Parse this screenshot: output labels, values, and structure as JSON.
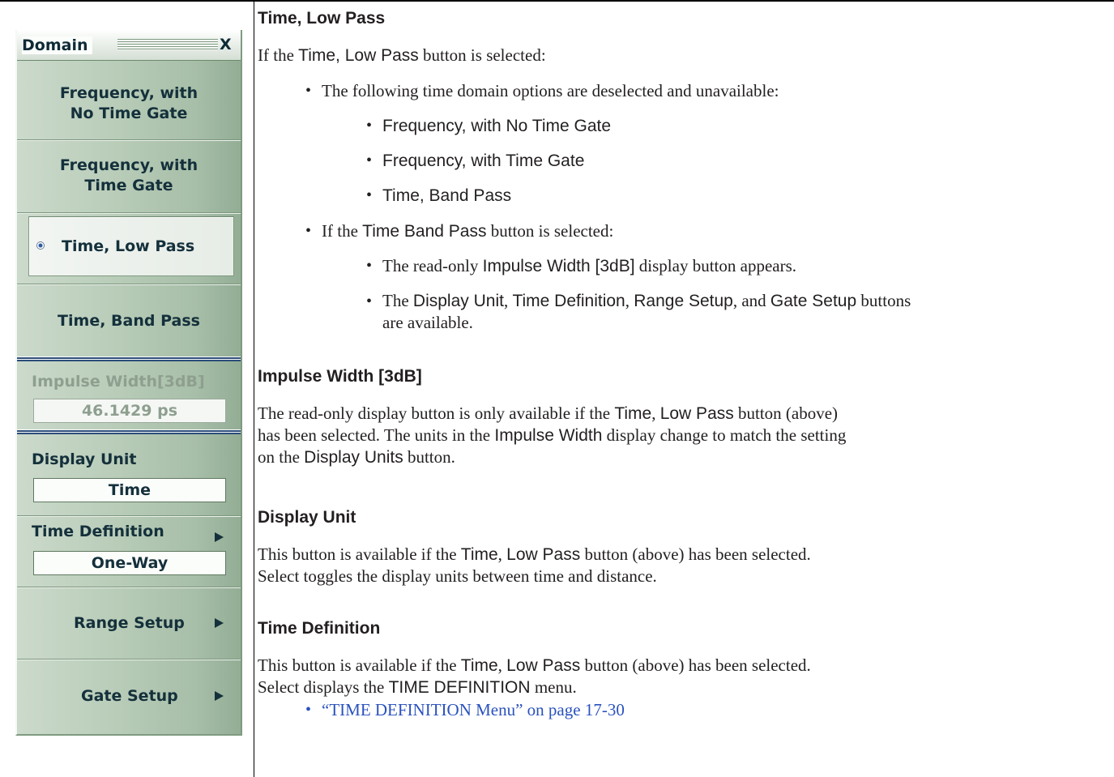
{
  "menu": {
    "title": "Domain",
    "close_label": "X",
    "buttons": {
      "freq_no_gate_line1": "Frequency, with",
      "freq_no_gate_line2": "No Time Gate",
      "freq_gate_line1": "Frequency, with",
      "freq_gate_line2": "Time Gate",
      "time_low_pass": "Time, Low Pass",
      "time_band_pass": "Time, Band Pass"
    },
    "impulse_width": {
      "label": "Impulse Width[3dB]",
      "value": "46.1429 ps"
    },
    "display_unit": {
      "label": "Display Unit",
      "value": "Time"
    },
    "time_definition": {
      "label": "Time Definition",
      "value": "One-Way"
    },
    "range_setup": "Range Setup",
    "gate_setup": "Gate Setup"
  },
  "doc": {
    "s1": {
      "heading": "Time, Low Pass",
      "intro": [
        "If the ",
        "Time, Low Pass",
        " button is selected:"
      ],
      "b1": "The following time domain options are deselected and unavailable:",
      "sub1": [
        "Frequency, with No Time Gate",
        "Frequency, with Time Gate",
        "Time, Band Pass"
      ],
      "b2": [
        "If the ",
        "Time Band Pass",
        " button is selected:"
      ],
      "sub2a": [
        "The read-only ",
        "Impulse Width [3dB]",
        " display button appears."
      ],
      "sub2b": [
        "The ",
        "Display Unit",
        ", ",
        "Time Definition",
        ", ",
        "Range Setup",
        ", and ",
        "Gate Setup",
        " buttons"
      ],
      "sub2b_cont": "are available."
    },
    "s2": {
      "heading": "Impulse Width [3dB]",
      "l1": [
        "The read-only display button is only available if the ",
        "Time",
        ", ",
        "Low Pass",
        " button (above)"
      ],
      "l2": [
        "has been selected. The units in the ",
        "Impulse Width",
        " display change to match the setting"
      ],
      "l3": [
        "on the ",
        "Display Units",
        " button."
      ]
    },
    "s3": {
      "heading": "Display Unit",
      "l1": [
        "This button is available if the ",
        "Time",
        ", ",
        "Low Pass",
        " button (above) has been selected."
      ],
      "l2": "Select toggles the display units between time and distance."
    },
    "s4": {
      "heading": "Time Definition",
      "l1": [
        "This button is available if the ",
        "Time",
        ", ",
        "Low Pass",
        " button (above) has been selected."
      ],
      "l2": [
        "Select displays the ",
        "TIME DEFINITION",
        " menu."
      ],
      "link": "“TIME DEFINITION Menu” on page 17-30"
    },
    "bullet_char": "•",
    "colors": {
      "link": "#2a52be",
      "menu_bg": "#b8ccb8",
      "menu_text": "#14303b",
      "separator_blue": "#2c4d7a"
    }
  }
}
